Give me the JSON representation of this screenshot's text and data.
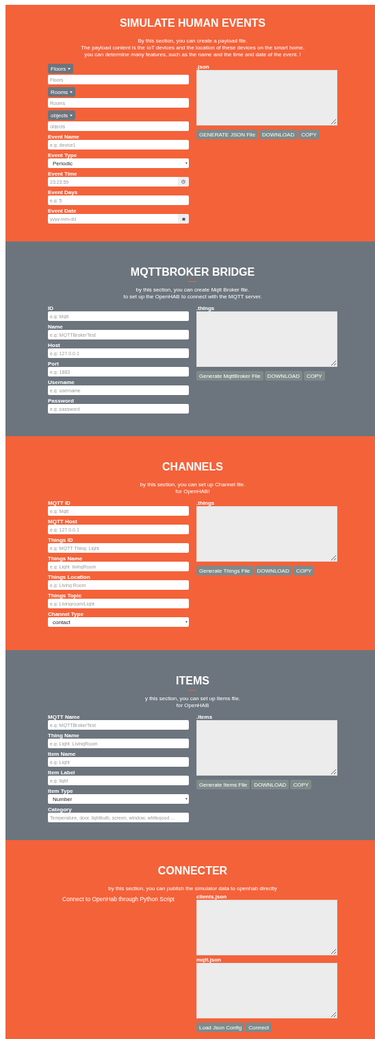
{
  "sections": [
    {
      "title": "SIMULATE HUMAN EVENTS",
      "color": "#f4623a",
      "description": [
        "By this section, you can create a payload file.",
        "The payload content is the IoT devices and the location of these devices on the smart home.",
        "you can determine many features, such as the name and the time and date of the event. !"
      ],
      "fields": [
        {
          "kind": "dropdown",
          "button": "Floors",
          "placeholder": "Floors"
        },
        {
          "kind": "dropdown",
          "button": "Rooms",
          "placeholder": "Rooms"
        },
        {
          "kind": "dropdown",
          "button": "objects",
          "placeholder": "objects"
        },
        {
          "kind": "text",
          "label": "Event Name",
          "placeholder": "e.g: device1"
        },
        {
          "kind": "select",
          "label": "Event Type",
          "value": "Periodic"
        },
        {
          "kind": "time",
          "label": "Event Time",
          "placeholder": "23:23:59"
        },
        {
          "kind": "text",
          "label": "Event Days",
          "placeholder": "e.g: 5"
        },
        {
          "kind": "date",
          "label": "Event Date",
          "placeholder": "yyyy-mm-dd"
        }
      ],
      "outputs": [
        {
          "label": ".json"
        }
      ],
      "buttons": [
        "GENERATE JSON File",
        "DOWNLOAD",
        "COPY"
      ]
    },
    {
      "title": "MQTTBROKER BRIDGE",
      "color": "#6c757d",
      "divider": true,
      "description": [
        "by this section, you can create Mqtt Broker file.",
        "to set up the OpenHAB to connect with the MQTT server."
      ],
      "fields": [
        {
          "kind": "text",
          "label": "ID",
          "placeholder": "e.g: Mqtt"
        },
        {
          "kind": "text",
          "label": "Name",
          "placeholder": "e.g: MQTTBrokerTest"
        },
        {
          "kind": "text",
          "label": "Host",
          "placeholder": "e.g: 127.0.0.1"
        },
        {
          "kind": "text",
          "label": "Port",
          "placeholder": "e.g: 1883"
        },
        {
          "kind": "text",
          "label": "Username",
          "placeholder": "e.g: username"
        },
        {
          "kind": "text",
          "label": "Password",
          "placeholder": "e.g: password"
        }
      ],
      "outputs": [
        {
          "label": ".things"
        }
      ],
      "buttons": [
        "Generate MqttBroker File",
        "DOWNLOAD",
        "COPY"
      ]
    },
    {
      "title": "CHANNELS",
      "color": "#f4623a",
      "description": [
        "by this section, you can set up Channel file.",
        "for OpenHAB!"
      ],
      "fields": [
        {
          "kind": "text",
          "label": "MQTT ID",
          "placeholder": "e.g: Mqtt"
        },
        {
          "kind": "text",
          "label": "MQTT Host",
          "placeholder": "e.g: 127.0.0.1"
        },
        {
          "kind": "text",
          "label": "Things ID",
          "placeholder": "e.g: MQTT Thing: Light"
        },
        {
          "kind": "text",
          "label": "Things Name",
          "placeholder": "e.g: Light_livingRoom"
        },
        {
          "kind": "text",
          "label": "Things Location",
          "placeholder": "e.g: Living Room"
        },
        {
          "kind": "text",
          "label": "Things Topic",
          "placeholder": "e.g: Livingroom/Light"
        },
        {
          "kind": "select",
          "label": "Channel Type",
          "value": "contact"
        }
      ],
      "outputs": [
        {
          "label": ".things"
        }
      ],
      "buttons": [
        "Generate Things File",
        "DOWNLOAD",
        "COPY"
      ]
    },
    {
      "title": "ITEMS",
      "color": "#6c757d",
      "divider": true,
      "description": [
        "y this section, you can set up Items file.",
        "for OpenHAB"
      ],
      "fields": [
        {
          "kind": "text",
          "label": "MQTT Name",
          "placeholder": "e.g: MQTTBrokerTest"
        },
        {
          "kind": "text",
          "label": "Thing Name",
          "placeholder": "e.g: Light_LivingRoom"
        },
        {
          "kind": "text",
          "label": "Item Name",
          "placeholder": "e.g: Light"
        },
        {
          "kind": "text",
          "label": "Item Label",
          "placeholder": "e.g: light"
        },
        {
          "kind": "select",
          "label": "Item Type",
          "value": "Number"
        },
        {
          "kind": "text",
          "label": "Category",
          "placeholder": "Temperature, door, lightbulb, screen, window, whitegood ..."
        }
      ],
      "outputs": [
        {
          "label": ".items"
        }
      ],
      "buttons": [
        "Generate Items File",
        "DOWNLOAD",
        "COPY"
      ]
    },
    {
      "title": "CONNECTER",
      "color": "#f4623a",
      "description": [
        "by this section, you can publish the simulator data to openhab directly"
      ],
      "side_text": "Connect to OpenHab through Python Script",
      "outputs": [
        {
          "label": "clients.json"
        },
        {
          "label": "mqtt.json"
        }
      ],
      "buttons": [
        "Load Json Config",
        "Connect"
      ]
    }
  ]
}
